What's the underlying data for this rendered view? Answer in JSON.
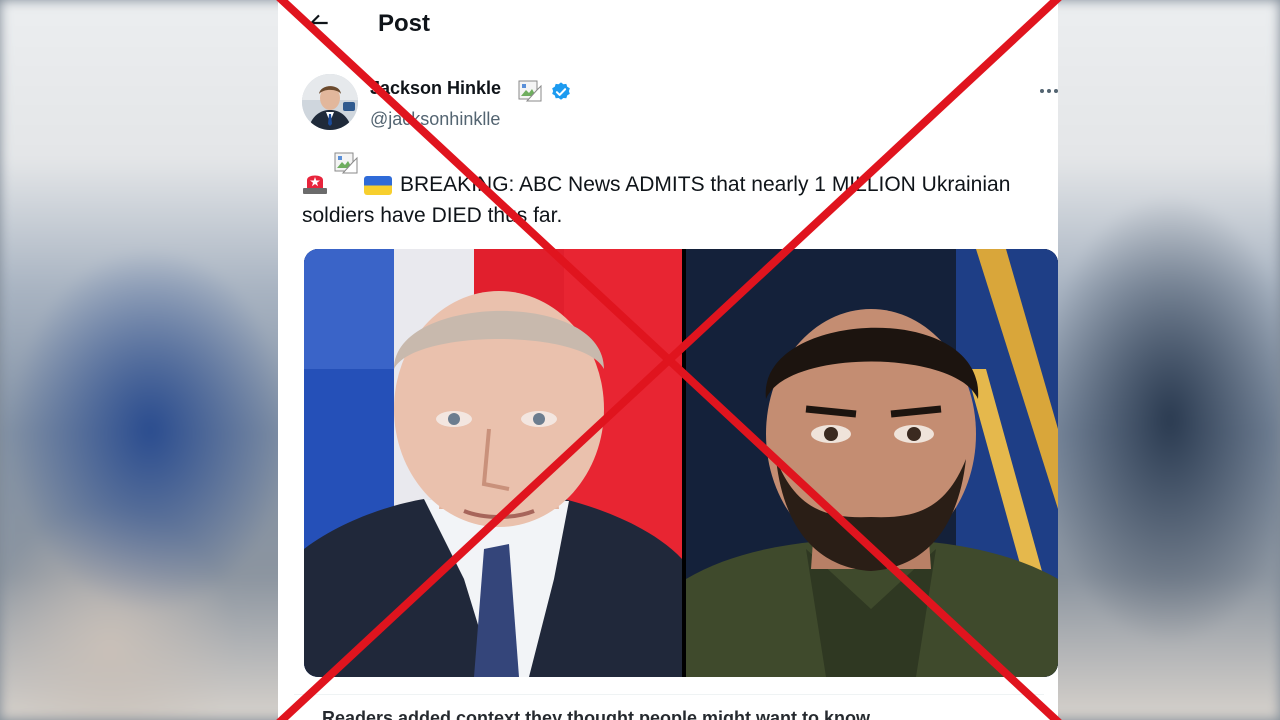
{
  "header": {
    "title": "Post",
    "back_icon": "arrow-left-icon"
  },
  "author": {
    "display_name": "Jackson Hinkle",
    "handle": "@jacksonhinklle",
    "verified_icon": "verified-badge-icon",
    "broken_image_icon": "broken-image-icon"
  },
  "post": {
    "emoji_siren": "siren-icon",
    "emoji_flag": "ukraine-flag-icon",
    "text_line1": "BREAKING: ABC News ADMITS that nearly 1 MILLION Ukrainian",
    "text_line2": "soldiers have DIED thus far.",
    "media_left": "portrait-photo",
    "media_right": "portrait-photo"
  },
  "footer": {
    "partial_text": "Readers added context they thought people might want to know"
  },
  "overlay": {
    "type": "red-x-cross",
    "color": "#e0141e"
  },
  "colors": {
    "text_primary": "#0f1419",
    "text_secondary": "#536471",
    "verified_blue": "#1d9bf0",
    "background": "#ffffff"
  }
}
